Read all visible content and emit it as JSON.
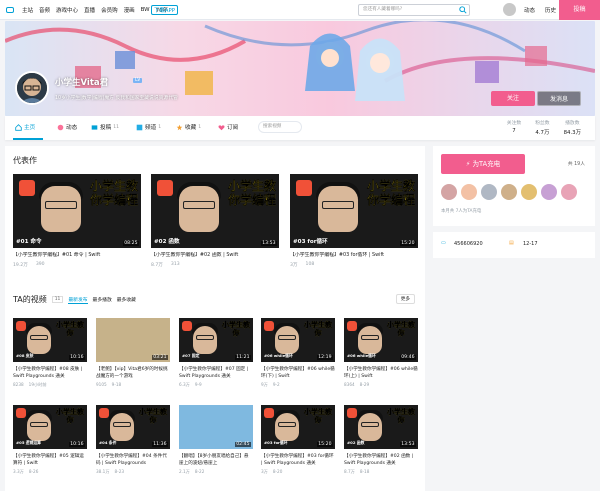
{
  "topbar": {
    "nav": [
      "主站",
      "音频",
      "游戏中心",
      "直播",
      "会员购",
      "漫画",
      "BW",
      "70年"
    ],
    "app_label": "下载APP",
    "search_placeholder": "您还有人藏着哪吗?",
    "right_links": [
      "动态",
      "历史"
    ],
    "upload_label": "投稿"
  },
  "profile": {
    "name": "小学生Vita君",
    "level": "LV",
    "signature": "10岁小学生|数学|编程|魔方 反我和国家宝藏说说资源代管",
    "follow_label": "关注",
    "message_label": "发消息"
  },
  "tabs": [
    {
      "label": "主页",
      "count": ""
    },
    {
      "label": "动态",
      "count": ""
    },
    {
      "label": "投稿",
      "count": "11"
    },
    {
      "label": "频道",
      "count": "1"
    },
    {
      "label": "收藏",
      "count": "1"
    },
    {
      "label": "订阅",
      "count": ""
    }
  ],
  "space_search_placeholder": "搜索视频",
  "stats": [
    {
      "label": "关注数",
      "value": "7"
    },
    {
      "label": "粉丝数",
      "value": "4.7万"
    },
    {
      "label": "播放数",
      "value": "84.3万"
    }
  ],
  "featured": {
    "title": "代表作",
    "items": [
      {
        "cap": "#01 命令",
        "thumb_title": "小学生教你学编程",
        "duration": "08:25",
        "title": "【小学生教你学编程】#01 命令 | Swift",
        "views": "19.2万",
        "danmaku": "390"
      },
      {
        "cap": "#02 函数",
        "thumb_title": "小学生教你学编程",
        "duration": "13:53",
        "title": "【小学生教你学编程】#02 函数 | Swift",
        "views": "8.7万",
        "danmaku": "313"
      },
      {
        "cap": "#03 for循环",
        "thumb_title": "小学生教你学编程",
        "duration": "15:20",
        "title": "【小学生教你学编程】#03 for循环 | Swift",
        "views": "3万",
        "danmaku": "108"
      }
    ]
  },
  "videos": {
    "title": "TA的视频",
    "count": "11",
    "sort": [
      "最新发布",
      "最多播放",
      "最多收藏"
    ],
    "more": "更多",
    "items": [
      {
        "cap": "#08 皮肤",
        "thumb_title": "小学生教你",
        "duration": "10:16",
        "title": "【小学生教你学编程】#08 皮肤 | Swift Playgrounds 通关",
        "views": "8238",
        "date": "19小时前"
      },
      {
        "cap": "",
        "thumb_title": "",
        "duration": "03:21",
        "title": "【老鲍】【vip】Vita君6岁的时候挑战魔方的一个游戏",
        "views": "9105",
        "date": "9-18"
      },
      {
        "cap": "#07 固定",
        "thumb_title": "小学生教你",
        "duration": "11:21",
        "title": "【小学生教你学编程】#07 固定 | Swift Playgrounds 通关",
        "views": "6.3万",
        "date": "9-9"
      },
      {
        "cap": "#06 while循环",
        "thumb_title": "小学生教你",
        "duration": "12:19",
        "title": "【小学生教你学编程】#06 while循环(下) | Swift",
        "views": "9万",
        "date": "9-2"
      },
      {
        "cap": "#06 while循环",
        "thumb_title": "小学生教你",
        "duration": "09:46",
        "title": "【小学生教你学编程】#06 while循环(上) | Swift",
        "views": "8364",
        "date": "8-29"
      },
      {
        "cap": "#05 逻辑运算",
        "thumb_title": "小学生教你",
        "duration": "10:16",
        "title": "【小学生教你学编程】#05 逻辑运算符 | Swift",
        "views": "3.3万",
        "date": "8-26"
      },
      {
        "cap": "#04 条件",
        "thumb_title": "小学生教你",
        "duration": "11:36",
        "title": "【小学生教你学编程】#04 条件代码 | Swift Playgrounds",
        "views": "38.1万",
        "date": "8-23"
      },
      {
        "cap": "",
        "thumb_title": "",
        "duration": "02:45",
        "title": "【翻唱】【8岁小朋友唱给自己】悬崖上的波妞/悬崖上",
        "views": "2.1万",
        "date": "8-22"
      },
      {
        "cap": "#03 for循环",
        "thumb_title": "小学生教你",
        "duration": "15:20",
        "title": "【小学生教你学编程】#03 for循环 | Swift Playgrounds 通关",
        "views": "3万",
        "date": "8-20"
      },
      {
        "cap": "#02 函数",
        "thumb_title": "小学生教你",
        "duration": "13:53",
        "title": "【小学生教你学编程】#02 函数 | Swift Playgrounds 通关",
        "views": "8.7万",
        "date": "8-18"
      }
    ]
  },
  "side": {
    "charge_label": "为TA充电",
    "charge_total": "共 19人",
    "charge_note": "本月共 7人为TA充电",
    "uid": "456606920",
    "birthday": "12-17"
  },
  "colors": {
    "accent": "#00a1d6",
    "pink": "#f25d8e"
  }
}
